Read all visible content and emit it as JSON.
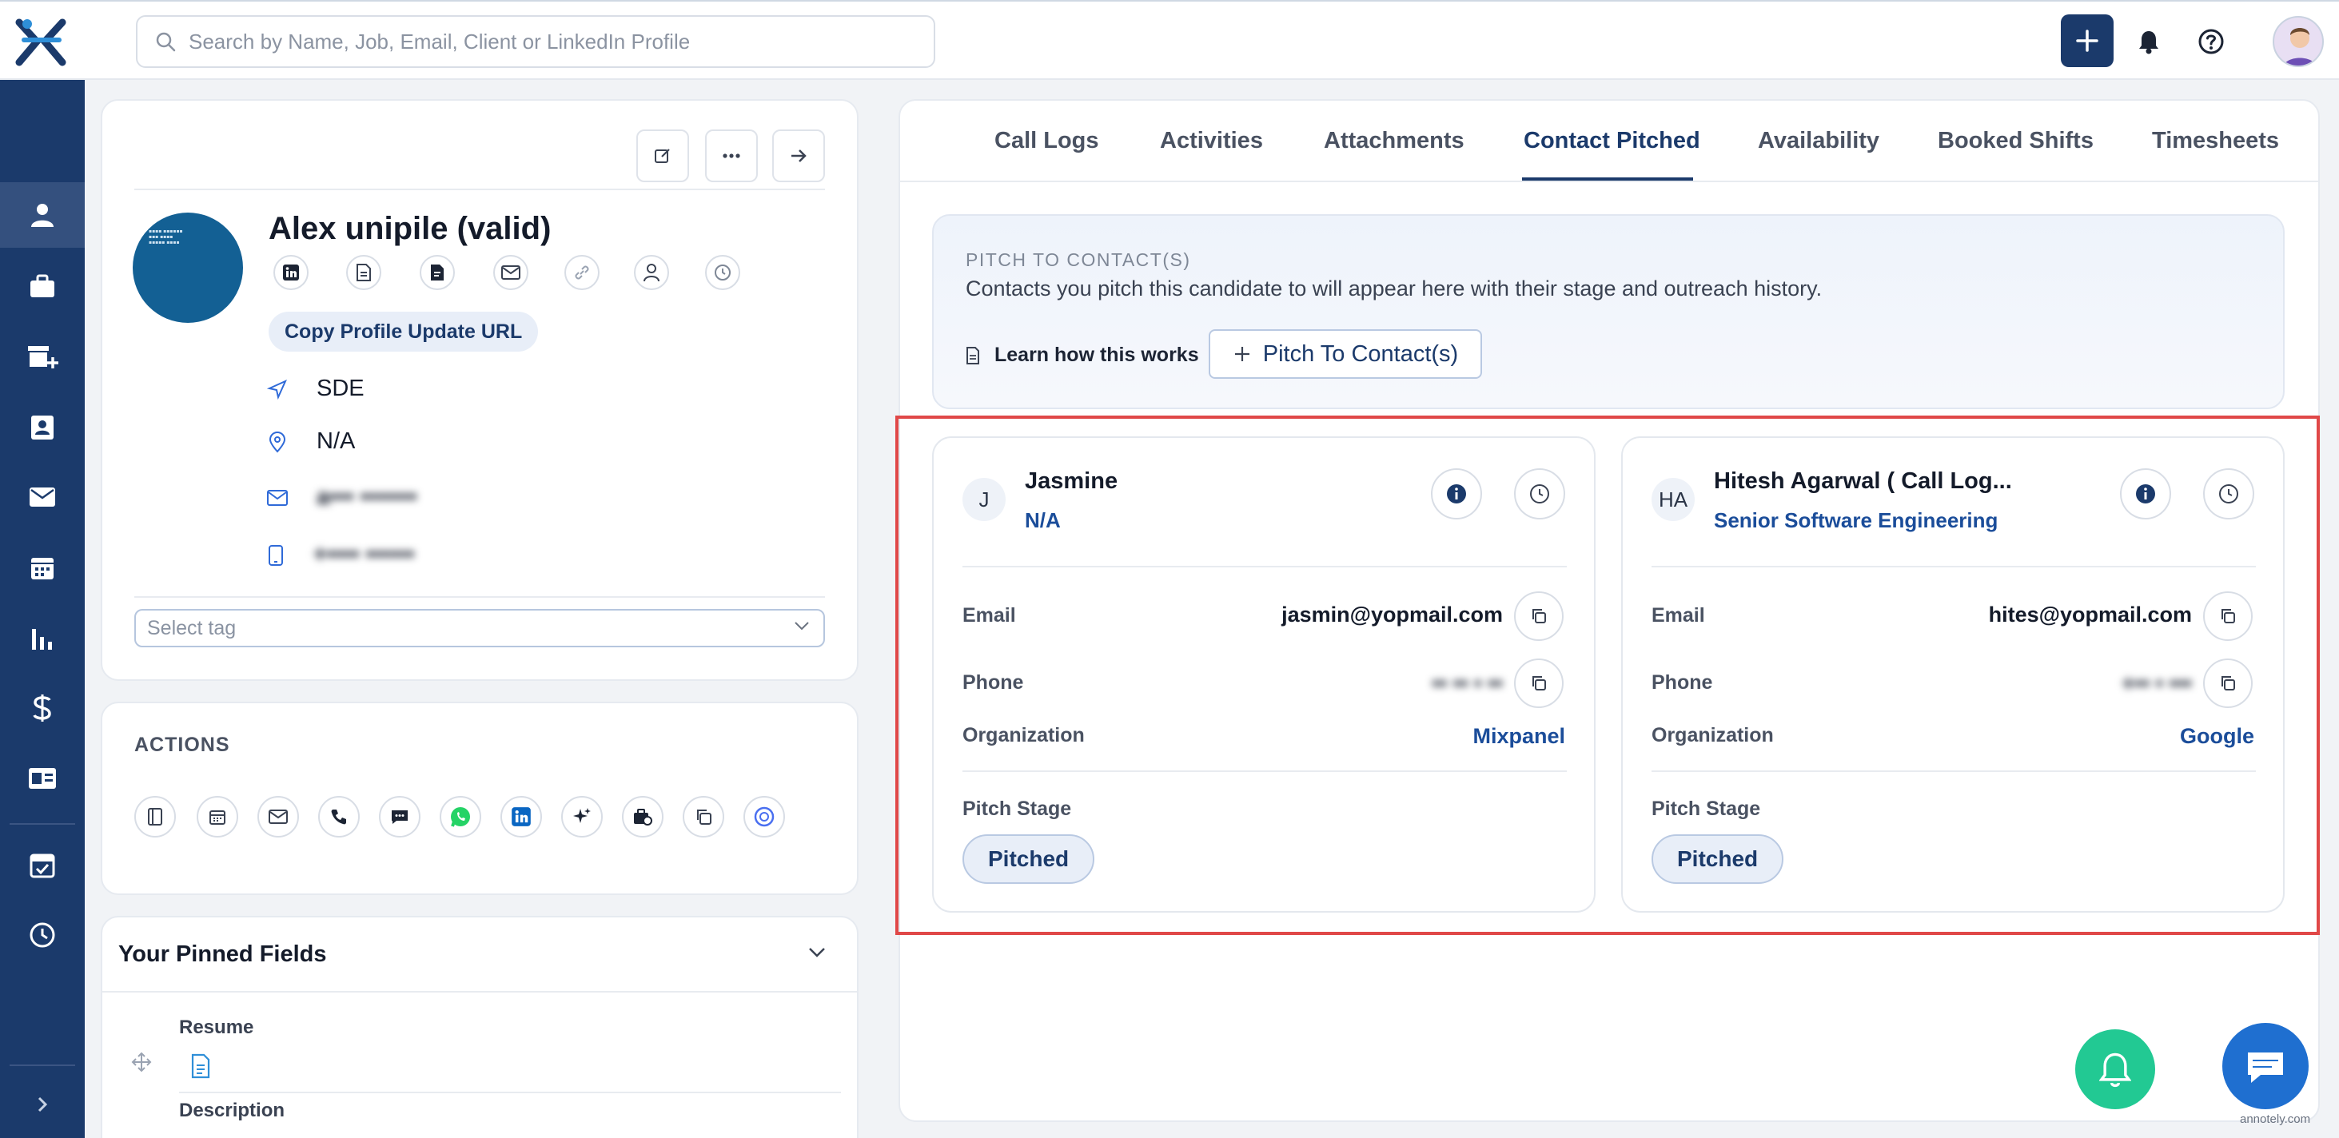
{
  "search": {
    "placeholder": "Search by Name, Job, Email, Client or LinkedIn Profile"
  },
  "profile": {
    "name": "Alex unipile (valid)",
    "copy_url_label": "Copy Profile Update URL",
    "job": "SDE",
    "location": "N/A",
    "email_masked": "a••• •••••••",
    "phone_masked": "+•••• ••••••",
    "tag_placeholder": "Select tag"
  },
  "actions": {
    "title": "ACTIONS"
  },
  "pinned": {
    "title": "Your Pinned Fields",
    "resume_label": "Resume",
    "description_label": "Description"
  },
  "tabs": [
    "Call Logs",
    "Activities",
    "Attachments",
    "Contact Pitched",
    "Availability",
    "Booked Shifts",
    "Timesheets"
  ],
  "active_tab": "Contact Pitched",
  "pitch": {
    "header": "PITCH TO CONTACT(S)",
    "description": "Contacts you pitch this candidate to will appear here with their stage and outreach history.",
    "learn_label": "Learn how this works",
    "button_label": "Pitch To Contact(s)"
  },
  "contacts": [
    {
      "initials": "J",
      "name": "Jasmine",
      "role": "N/A",
      "email_label": "Email",
      "email": "jasmin@yopmail.com",
      "phone_label": "Phone",
      "phone_masked": "••   ••  • ••",
      "org_label": "Organization",
      "organization": "Mixpanel",
      "stage_label": "Pitch Stage",
      "stage": "Pitched"
    },
    {
      "initials": "HA",
      "name": "Hitesh Agarwal ( Call Log...",
      "role": "Senior Software Engineering",
      "email_label": "Email",
      "email": "hites@yopmail.com",
      "phone_label": "Phone",
      "phone_masked": "+•• •      •••",
      "org_label": "Organization",
      "organization": "Google",
      "stage_label": "Pitch Stage",
      "stage": "Pitched"
    }
  ],
  "watermark": "annotely.com",
  "colors": {
    "brand": "#1b3a6b",
    "accent_link": "#1b4d9a",
    "highlight": "#e04848",
    "fab_green": "#22c993",
    "fab_blue": "#1f6fd0"
  }
}
